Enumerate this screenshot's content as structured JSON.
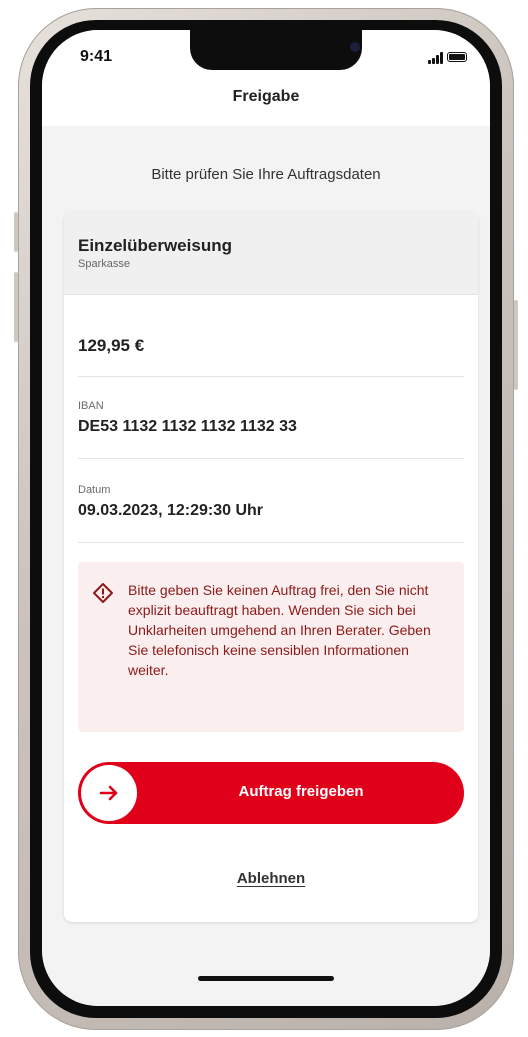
{
  "status_bar": {
    "time": "9:41"
  },
  "header": {
    "title": "Freigabe"
  },
  "main": {
    "subtitle": "Bitte prüfen Sie Ihre Auftragsdaten",
    "order": {
      "type": "Einzelüberweisung",
      "bank": "Sparkasse",
      "amount": "129,95 €",
      "iban_label": "IBAN",
      "iban": "DE53 1132 1132 1132 1132 33",
      "date_label": "Datum",
      "date": "09.03.2023, 12:29:30 Uhr"
    },
    "warning": {
      "icon": "warning-diamond-icon",
      "text": "Bitte geben Sie keinen Auftrag frei, den Sie nicht explizit beauftragt haben. Wenden Sie sich bei Unklarheiten umgehend an Ihren Berater. Geben Sie telefonisch keine sensiblen Informationen weiter."
    },
    "approve_button": {
      "label": "Auftrag freigeben",
      "icon": "arrow-right-icon"
    },
    "reject_link": {
      "label": "Ablehnen"
    }
  },
  "colors": {
    "accent": "#e1001a",
    "warning_bg": "#fbeeee",
    "warning_text": "#8b1a1a"
  }
}
